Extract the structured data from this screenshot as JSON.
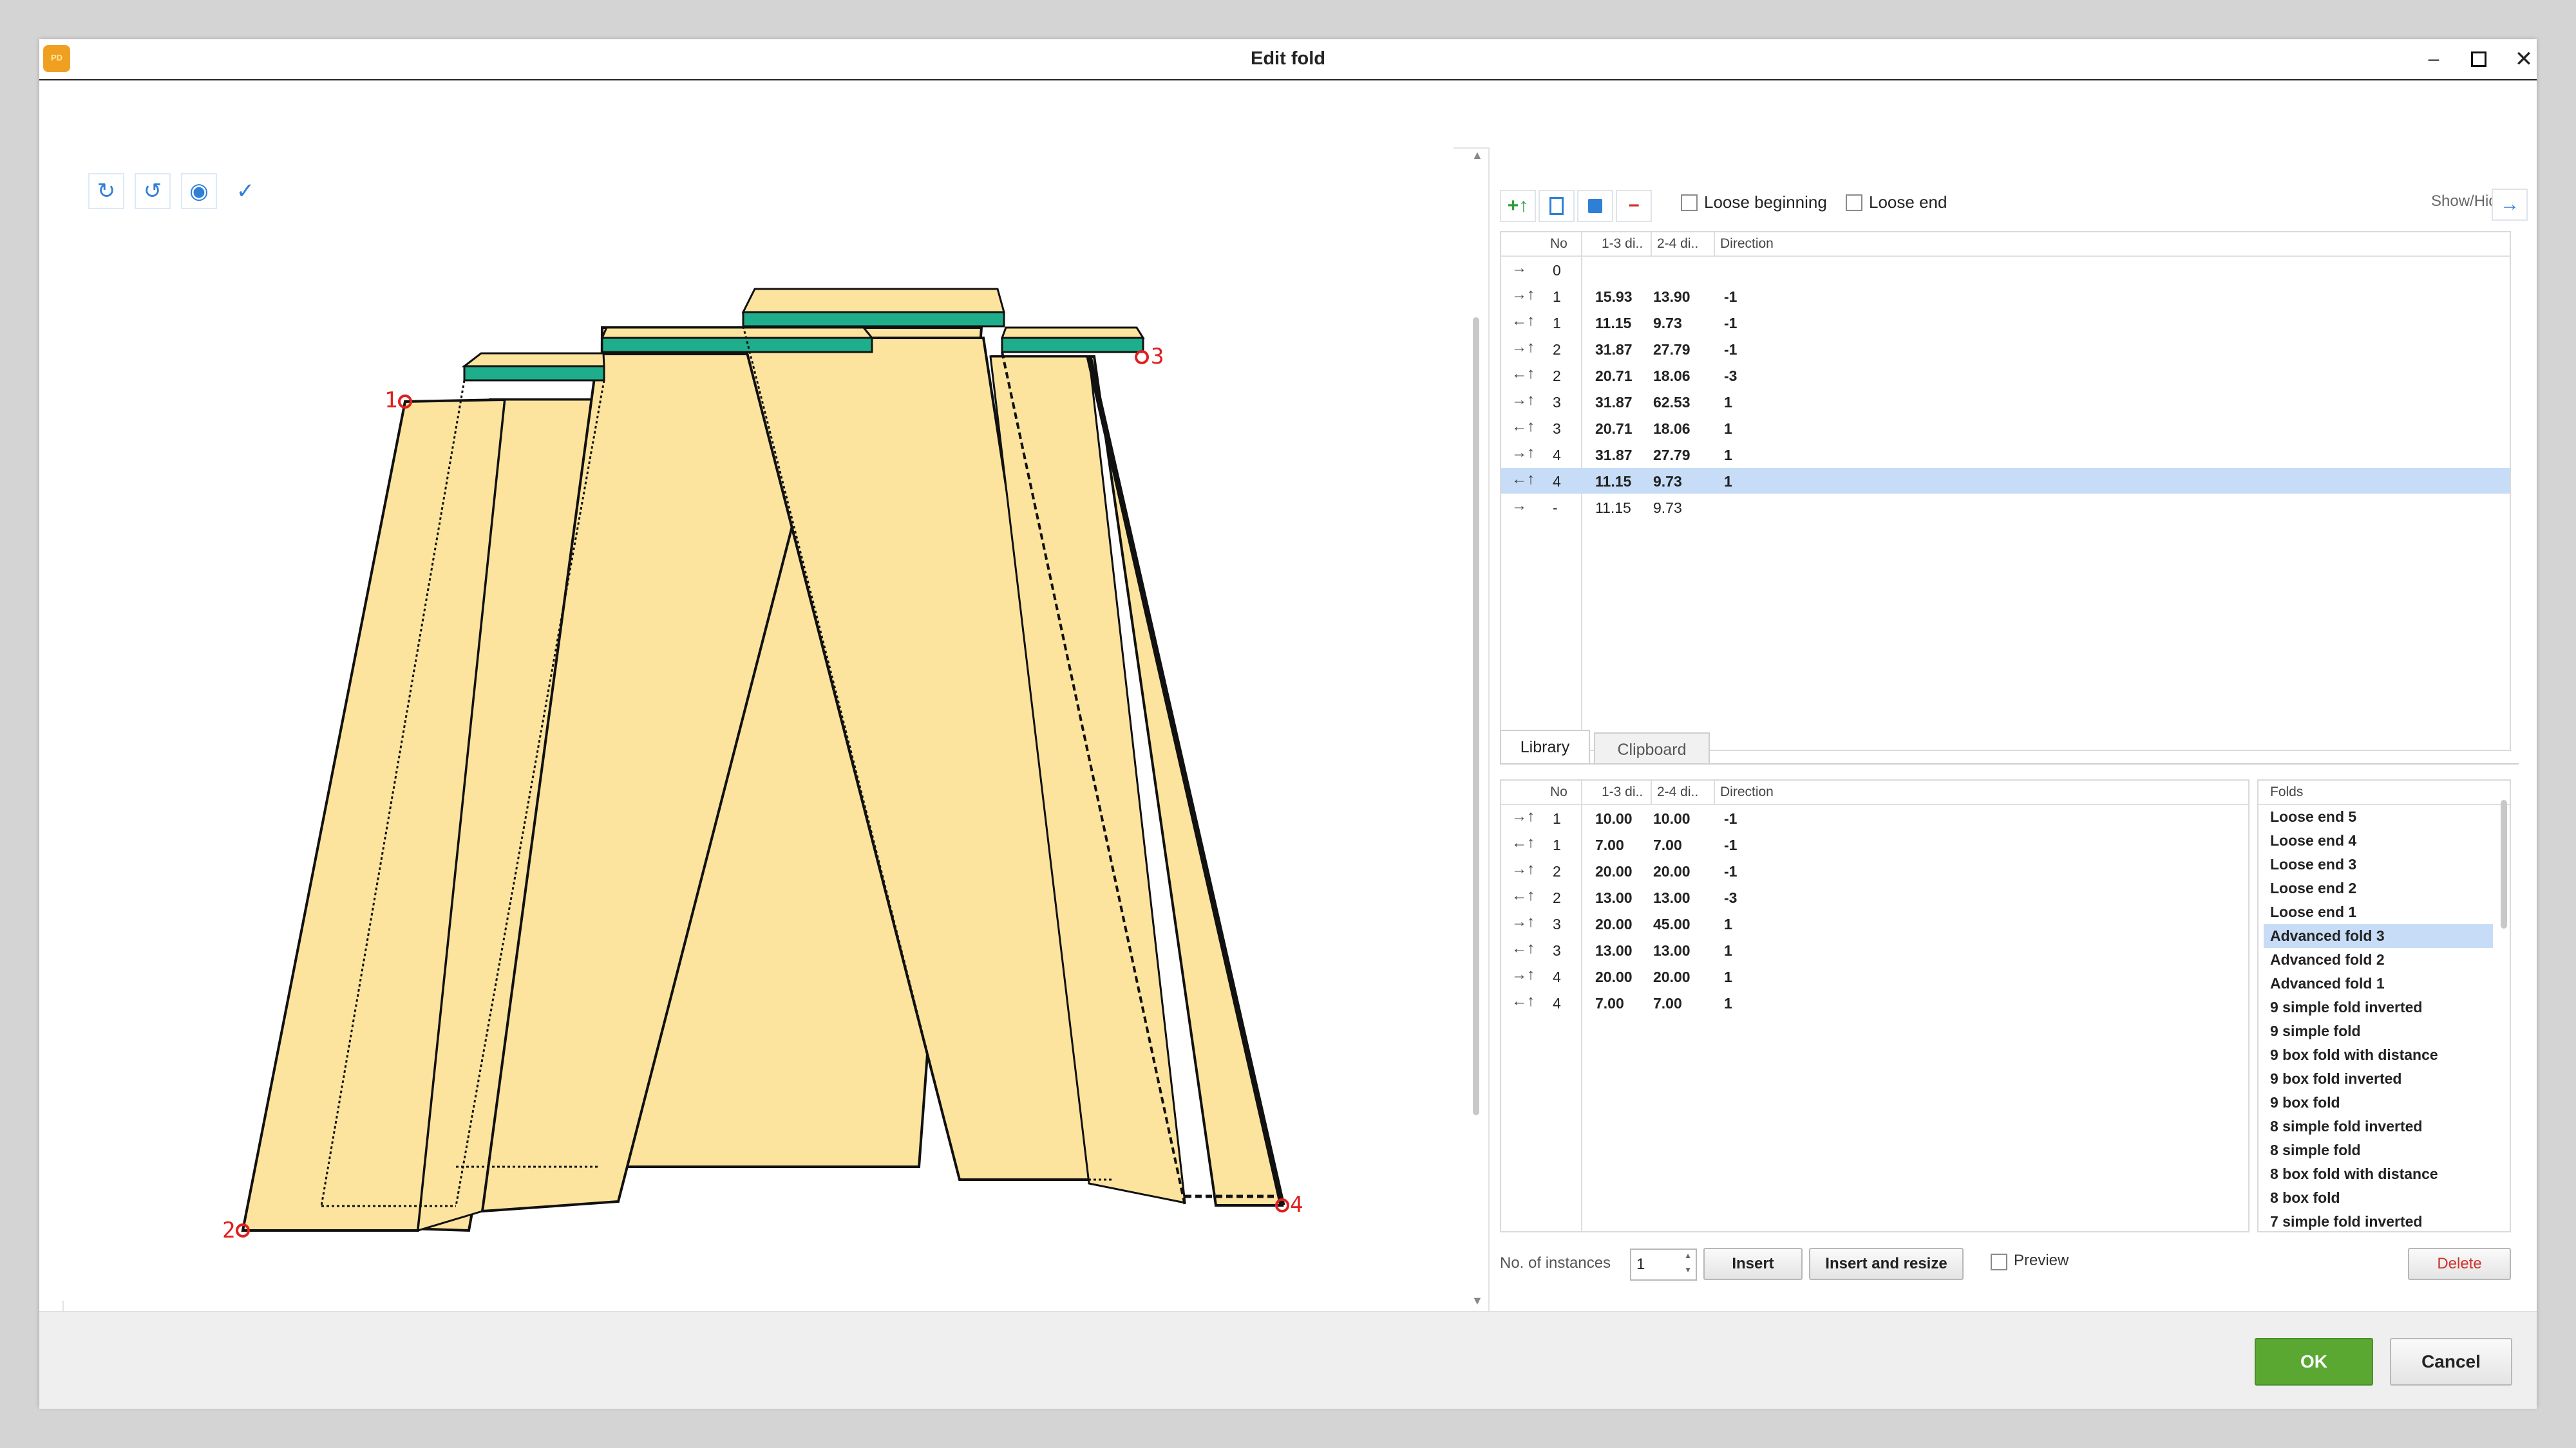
{
  "window": {
    "title": "Edit fold"
  },
  "canvas": {
    "toolbar": [
      "rotate-cw-icon",
      "rotate-ccw-icon",
      "zoom-fit-icon",
      "visibility-icon"
    ],
    "labels": {
      "p1": "1",
      "p2": "2",
      "p3": "3",
      "p4": "4"
    }
  },
  "right_toolbar": {
    "add_label": "+↑",
    "remove_label": "−",
    "loose_beginning": "Loose beginning",
    "loose_end": "Loose end",
    "show_hide": "Show/Hide"
  },
  "fold_table": {
    "headers": [
      "No",
      "1-3 di..",
      "2-4 di..",
      "Direction"
    ],
    "rows": [
      {
        "icon": "→",
        "no": "0",
        "d13": "",
        "d24": "",
        "dir": "",
        "bold": false,
        "selected": false
      },
      {
        "icon": "→↑",
        "no": "1",
        "d13": "15.93",
        "d24": "13.90",
        "dir": "-1",
        "bold": true,
        "selected": false
      },
      {
        "icon": "←↑",
        "no": "1",
        "d13": "11.15",
        "d24": "9.73",
        "dir": "-1",
        "bold": true,
        "selected": false
      },
      {
        "icon": "→↑",
        "no": "2",
        "d13": "31.87",
        "d24": "27.79",
        "dir": "-1",
        "bold": true,
        "selected": false
      },
      {
        "icon": "←↑",
        "no": "2",
        "d13": "20.71",
        "d24": "18.06",
        "dir": "-3",
        "bold": true,
        "selected": false
      },
      {
        "icon": "→↑",
        "no": "3",
        "d13": "31.87",
        "d24": "62.53",
        "dir": "1",
        "bold": true,
        "selected": false
      },
      {
        "icon": "←↑",
        "no": "3",
        "d13": "20.71",
        "d24": "18.06",
        "dir": "1",
        "bold": true,
        "selected": false
      },
      {
        "icon": "→↑",
        "no": "4",
        "d13": "31.87",
        "d24": "27.79",
        "dir": "1",
        "bold": true,
        "selected": false
      },
      {
        "icon": "←↑",
        "no": "4",
        "d13": "11.15",
        "d24": "9.73",
        "dir": "1",
        "bold": true,
        "selected": true
      },
      {
        "icon": "→",
        "no": "-",
        "d13": "11.15",
        "d24": "9.73",
        "dir": "",
        "bold": false,
        "selected": false
      }
    ]
  },
  "tabs": {
    "library": "Library",
    "clipboard": "Clipboard"
  },
  "library_table": {
    "headers": [
      "No",
      "1-3 di..",
      "2-4 di..",
      "Direction"
    ],
    "rows": [
      {
        "icon": "→↑",
        "no": "1",
        "d13": "10.00",
        "d24": "10.00",
        "dir": "-1"
      },
      {
        "icon": "←↑",
        "no": "1",
        "d13": "7.00",
        "d24": "7.00",
        "dir": "-1"
      },
      {
        "icon": "→↑",
        "no": "2",
        "d13": "20.00",
        "d24": "20.00",
        "dir": "-1"
      },
      {
        "icon": "←↑",
        "no": "2",
        "d13": "13.00",
        "d24": "13.00",
        "dir": "-3"
      },
      {
        "icon": "→↑",
        "no": "3",
        "d13": "20.00",
        "d24": "45.00",
        "dir": "1"
      },
      {
        "icon": "←↑",
        "no": "3",
        "d13": "13.00",
        "d24": "13.00",
        "dir": "1"
      },
      {
        "icon": "→↑",
        "no": "4",
        "d13": "20.00",
        "d24": "20.00",
        "dir": "1"
      },
      {
        "icon": "←↑",
        "no": "4",
        "d13": "7.00",
        "d24": "7.00",
        "dir": "1"
      }
    ]
  },
  "folds": {
    "header": "Folds",
    "items": [
      "Loose end 5",
      "Loose end 4",
      "Loose end 3",
      "Loose end 2",
      "Loose end 1",
      "Advanced fold 3",
      "Advanced fold 2",
      "Advanced fold 1",
      "9 simple fold inverted",
      "9 simple fold",
      "9 box fold with distance",
      "9 box fold inverted",
      "9 box fold",
      "8 simple fold inverted",
      "8 simple fold",
      "8 box fold with distance",
      "8 box fold",
      "7 simple fold inverted"
    ],
    "selected": "Advanced fold 3"
  },
  "bottom": {
    "instances_label": "No. of instances",
    "instances_value": "1",
    "insert": "Insert",
    "insert_resize": "Insert and resize",
    "preview": "Preview",
    "delete": "Delete"
  },
  "footer": {
    "ok": "OK",
    "cancel": "Cancel"
  },
  "colors": {
    "accent": "#5aa832",
    "delete": "#d0312d",
    "fold_fill": "#fde49e",
    "fold_teal": "#1fae8c",
    "selection": "#c7dcf7",
    "marker": "#e02020"
  }
}
